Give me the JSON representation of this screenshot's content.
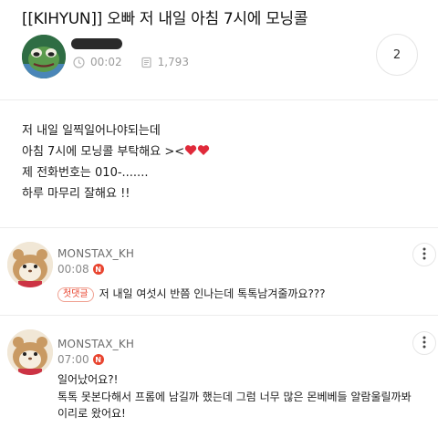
{
  "post": {
    "title": "[[KIHYUN]] 오빠 저 내일 아침 7시에 모닝콜",
    "elapsed": "00:02",
    "views": "1,793",
    "comment_count": "2",
    "body": {
      "line1": "저 내일 일찍일어나야되는데",
      "line2_text": "아침 7시에 모닝콜 부탁해요 ><",
      "line3": "제 전화번호는 010-.......",
      "line4": "하루 마무리 잘해요 !!"
    }
  },
  "comments": [
    {
      "author": "MONSTAX_KH",
      "time": "00:08",
      "new_badge": "N",
      "first_badge": "첫댓글",
      "text": "저 내일 여섯시 반쯤 인나는데 톡톡남겨줄까요???"
    },
    {
      "author": "MONSTAX_KH",
      "time": "07:00",
      "new_badge": "N",
      "lines": [
        "일어났어요?!",
        "톡톡 못본다해서 프롬에 남길까 했는데 그럼 너무 많은 몬베베들 알람울릴까봐",
        "이리로 왔어요!"
      ]
    }
  ],
  "colors": {
    "accent_red": "#e8442f",
    "heart_red": "#e02a3a",
    "meta_gray": "#9b9b9b"
  },
  "icons": {
    "clock": "clock-icon",
    "views": "document-icon",
    "more": "more-vertical-icon",
    "heart": "heart-icon"
  }
}
